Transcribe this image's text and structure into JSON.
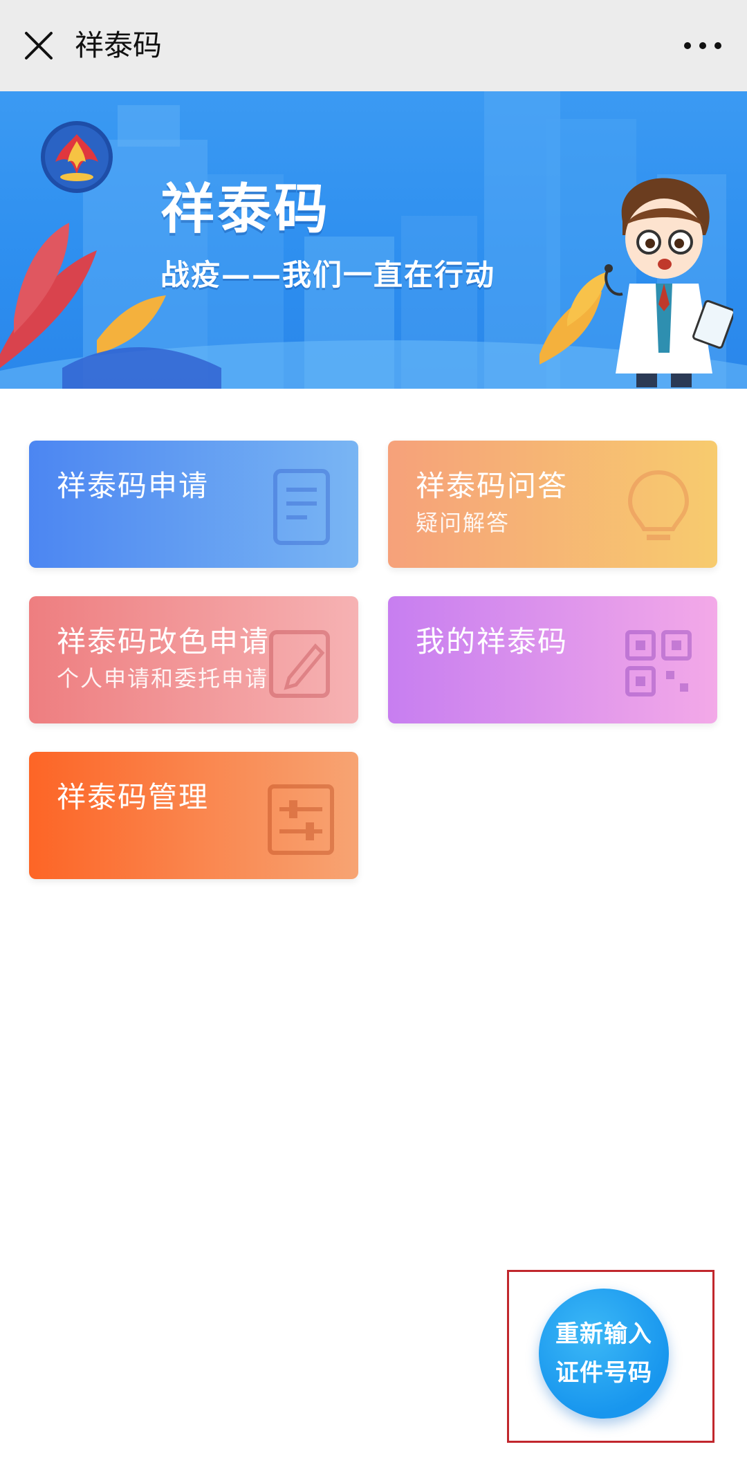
{
  "header": {
    "title": "祥泰码",
    "close_icon": "close-icon",
    "more_icon": "more-icon"
  },
  "banner": {
    "title": "祥泰码",
    "subtitle": "战疫——我们一直在行动",
    "colors": {
      "background": "#2d8eef",
      "text": "#ffffff"
    }
  },
  "cards": [
    {
      "title": "祥泰码申请",
      "subtitle": "",
      "icon": "document-icon",
      "colors": [
        "#4c86f2",
        "#79b5f3"
      ]
    },
    {
      "title": "祥泰码问答",
      "subtitle": "疑问解答",
      "icon": "lightbulb-icon",
      "colors": [
        "#f6a17a",
        "#f7cb6e"
      ]
    },
    {
      "title": "祥泰码改色申请",
      "subtitle": "个人申请和委托申请",
      "icon": "edit-icon",
      "colors": [
        "#ee7e80",
        "#f6b2b3"
      ]
    },
    {
      "title": "我的祥泰码",
      "subtitle": "",
      "icon": "qrcode-icon",
      "colors": [
        "#c77ef0",
        "#f3a9e8"
      ]
    },
    {
      "title": "祥泰码管理",
      "subtitle": "",
      "icon": "sliders-icon",
      "colors": [
        "#fd6526",
        "#f7a473"
      ]
    }
  ],
  "fab": {
    "line1": "重新输入",
    "line2": "证件号码",
    "color": "#1896ee",
    "highlight_color": "#c1272d"
  }
}
